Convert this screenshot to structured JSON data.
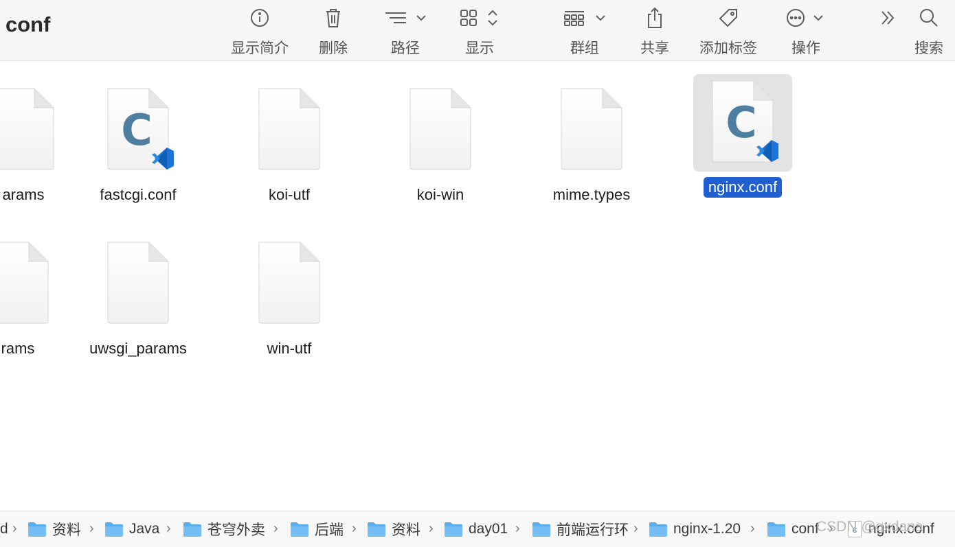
{
  "window": {
    "title": "conf"
  },
  "toolbar": {
    "get_info": "显示简介",
    "delete": "删除",
    "path": "路径",
    "view": "显示",
    "group": "群组",
    "share": "共享",
    "add_tags": "添加标签",
    "action": "操作",
    "search": "搜索"
  },
  "files": [
    {
      "name": "fastcgi_params",
      "visible_name": "arams",
      "icon": "blank-doc-icon"
    },
    {
      "name": "fastcgi.conf",
      "icon": "vscode-c-doc-icon"
    },
    {
      "name": "koi-utf",
      "icon": "blank-doc-icon"
    },
    {
      "name": "koi-win",
      "icon": "blank-doc-icon"
    },
    {
      "name": "mime.types",
      "icon": "blank-doc-icon"
    },
    {
      "name": "nginx.conf",
      "icon": "vscode-c-doc-icon",
      "selected": true
    },
    {
      "name": "scgi_params",
      "visible_name": "rams",
      "icon": "blank-doc-icon"
    },
    {
      "name": "uwsgi_params",
      "icon": "blank-doc-icon"
    },
    {
      "name": "win-utf",
      "icon": "blank-doc-icon"
    }
  ],
  "pathbar": {
    "items": [
      "d",
      "资料",
      "Java",
      "苍穹外卖",
      "后端",
      "资料",
      "day01",
      "前端运行环",
      "nginx-1.20",
      "conf",
      "c",
      "nginx.conf"
    ]
  },
  "watermark": "CSDN @gxdana",
  "colors": {
    "selection": "#1f5fd1",
    "folder": "#5aaef0",
    "c_letter": "#4f7fa0",
    "vscode_blue": "#1e74d4"
  }
}
